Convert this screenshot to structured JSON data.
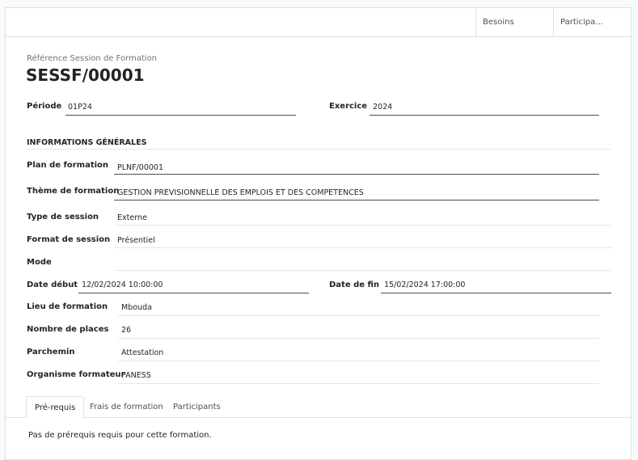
{
  "buttonbox": {
    "besoins_label": "Besoins",
    "participants_label": "Participa..."
  },
  "header": {
    "ref_label": "Référence Session de Formation",
    "ref_value": "SESSF/00001"
  },
  "fields": {
    "periode": {
      "label": "Période",
      "value": "01P24"
    },
    "exercice": {
      "label": "Exercice",
      "value": "2024"
    },
    "section_title": "INFORMATIONS GÉNÉRALES",
    "plan": {
      "label": "Plan de formation",
      "value": "PLNF/00001"
    },
    "theme": {
      "label": "Thème de formation",
      "value": "GESTION PREVISIONNELLE DES EMPLOIS ET DES COMPETENCES"
    },
    "type_session": {
      "label": "Type de session",
      "value": "Externe"
    },
    "format_session": {
      "label": "Format de session",
      "value": "Présentiel"
    },
    "mode": {
      "label": "Mode",
      "value": ""
    },
    "date_debut": {
      "label": "Date début",
      "value": "12/02/2024 10:00:00"
    },
    "date_fin": {
      "label": "Date de fin",
      "value": "15/02/2024 17:00:00"
    },
    "lieu": {
      "label": "Lieu de formation",
      "value": "Mbouda"
    },
    "places": {
      "label": "Nombre de places",
      "value": "26"
    },
    "parchemin": {
      "label": "Parchemin",
      "value": "Attestation"
    },
    "organisme": {
      "label": "Organisme formateur",
      "value": "PANESS"
    }
  },
  "tabs": [
    {
      "label": "Pré-requis",
      "active": true
    },
    {
      "label": "Frais de formation",
      "active": false
    },
    {
      "label": "Participants",
      "active": false
    }
  ],
  "tab_content": "Pas de prérequis requis pour cette formation."
}
